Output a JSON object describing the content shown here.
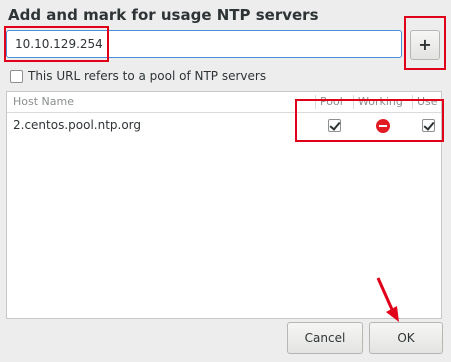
{
  "dialog": {
    "title": "Add and mark for usage NTP servers",
    "url_input_value": "10.10.129.254",
    "add_button_label": "+",
    "pool_checkbox_label": "This URL refers to a pool of NTP servers",
    "pool_checkbox_checked": false
  },
  "server_list": {
    "columns": [
      "Host Name",
      "Pool",
      "Working",
      "Use"
    ],
    "rows": [
      {
        "host": "2.centos.pool.ntp.org",
        "pool": true,
        "working": "not-working",
        "use": true
      }
    ]
  },
  "buttons": {
    "cancel": "Cancel",
    "ok": "OK"
  },
  "annotations": {
    "color": "#e0001a"
  }
}
